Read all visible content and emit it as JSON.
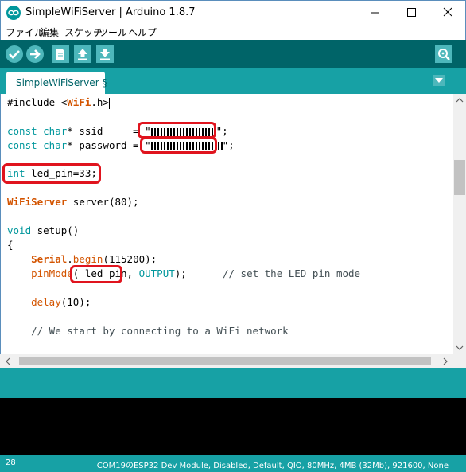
{
  "window": {
    "title": "SimpleWiFiServer | Arduino 1.8.7"
  },
  "menu": [
    "ファイル",
    "編集",
    "スケッチ",
    "ツール",
    "ヘルプ"
  ],
  "toolbar": {
    "buttons": [
      "verify-icon",
      "upload-icon",
      "new-icon",
      "open-icon",
      "save-icon",
      "serial-monitor-icon"
    ]
  },
  "tabs": [
    {
      "label": "SimpleWiFiServer §"
    }
  ],
  "code": {
    "l1_a": "#include <",
    "l1_b": "WiFi",
    "l1_c": ".h>",
    "l2_a": "const char",
    "l2_b": "* ssid     = \"",
    "l2_c": "\";",
    "l3_a": "const char",
    "l3_b": "* password = \"",
    "l3_c": "\";",
    "l4_a": "int",
    "l4_b": " led_pin=33;",
    "l5_a": "WiFiServer",
    "l5_b": " server(80);",
    "l6_a": "void",
    "l6_b": " setup()",
    "l7": "{",
    "l8_a": "    ",
    "l8_b": "Serial",
    "l8_c": ".",
    "l8_d": "begin",
    "l8_e": "(115200);",
    "l9_a": "    ",
    "l9_b": "pinMode",
    "l9_c": "( led_pin, ",
    "l9_d": "OUTPUT",
    "l9_e": ");      ",
    "l9_f": "// set the LED pin mode",
    "l10_a": "    ",
    "l10_b": "delay",
    "l10_c": "(10);",
    "l11_a": "    ",
    "l11_b": "// We start by connecting to a WiFi network"
  },
  "status": {
    "line_number": "28",
    "board": "COM19のESP32 Dev Module, Disabled, Default, QIO, 80MHz, 4MB (32Mb), 921600, None"
  },
  "colors": {
    "toolbar": "#006468",
    "tabstrip": "#17a1a5",
    "annotation": "#e0141e"
  }
}
